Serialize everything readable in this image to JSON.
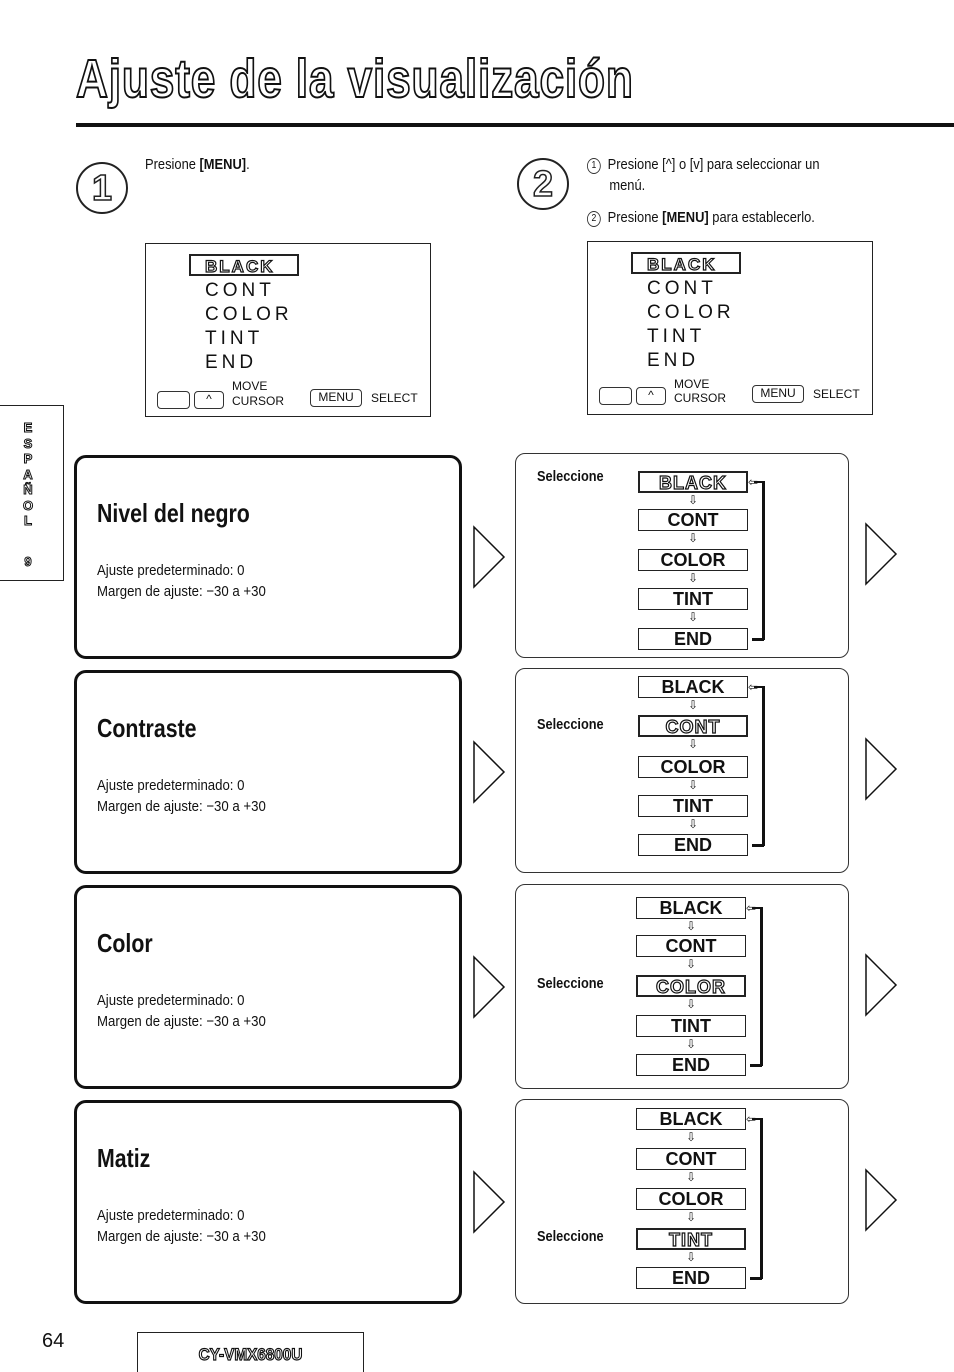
{
  "page": {
    "title": "Ajuste de la visualización",
    "side_tab": {
      "letters": [
        "E",
        "S",
        "P",
        "A",
        "Ñ",
        "O",
        "L"
      ],
      "number": "9"
    },
    "page_number": "64",
    "model": "CY-VMX6800U"
  },
  "step1": {
    "number": "1",
    "text_prefix": "Presione ",
    "text_key": "[MENU]",
    "text_suffix": ".",
    "screen": {
      "items": [
        "BLACK",
        "CONT",
        "COLOR",
        "TINT",
        "END"
      ],
      "selected": "BLACK",
      "key_up": "^",
      "move_label": "MOVE",
      "cursor_label": "CURSOR",
      "menu_key": "MENU",
      "select_label": "SELECT"
    }
  },
  "step2": {
    "number": "2",
    "sub1": {
      "num": "1",
      "line1": "Presione [^] o [v] para seleccionar un",
      "line2": "menú."
    },
    "sub2": {
      "num": "2",
      "prefix": "Presione ",
      "key": "[MENU]",
      "suffix": " para establecerlo."
    },
    "screen": {
      "items": [
        "BLACK",
        "CONT",
        "COLOR",
        "TINT",
        "END"
      ],
      "selected": "BLACK",
      "key_up": "^",
      "move_label": "MOVE",
      "cursor_label": "CURSOR",
      "menu_key": "MENU",
      "select_label": "SELECT"
    }
  },
  "settings": [
    {
      "title": "Nivel del negro",
      "default": "Ajuste predeterminado: 0",
      "range": "Margen de ajuste: −30 a +30",
      "flow_label": "Seleccione",
      "flow_items": [
        "BLACK",
        "CONT",
        "COLOR",
        "TINT",
        "END"
      ],
      "active_index": 0
    },
    {
      "title": "Contraste",
      "default": "Ajuste predeterminado: 0",
      "range": "Margen de ajuste: −30 a +30",
      "flow_label": "Seleccione",
      "flow_items": [
        "BLACK",
        "CONT",
        "COLOR",
        "TINT",
        "END"
      ],
      "active_index": 1
    },
    {
      "title": "Color",
      "default": "Ajuste predeterminado: 0",
      "range": "Margen de ajuste: −30 a +30",
      "flow_label": "Seleccione",
      "flow_items": [
        "BLACK",
        "CONT",
        "COLOR",
        "TINT",
        "END"
      ],
      "active_index": 2
    },
    {
      "title": "Matiz",
      "default": "Ajuste predeterminado: 0",
      "range": "Margen de ajuste: −30 a +30",
      "flow_label": "Seleccione",
      "flow_items": [
        "BLACK",
        "CONT",
        "COLOR",
        "TINT",
        "END"
      ],
      "active_index": 3
    }
  ],
  "glyphs": {
    "down_arrow": "⇩",
    "left_arrow": "⇦"
  }
}
